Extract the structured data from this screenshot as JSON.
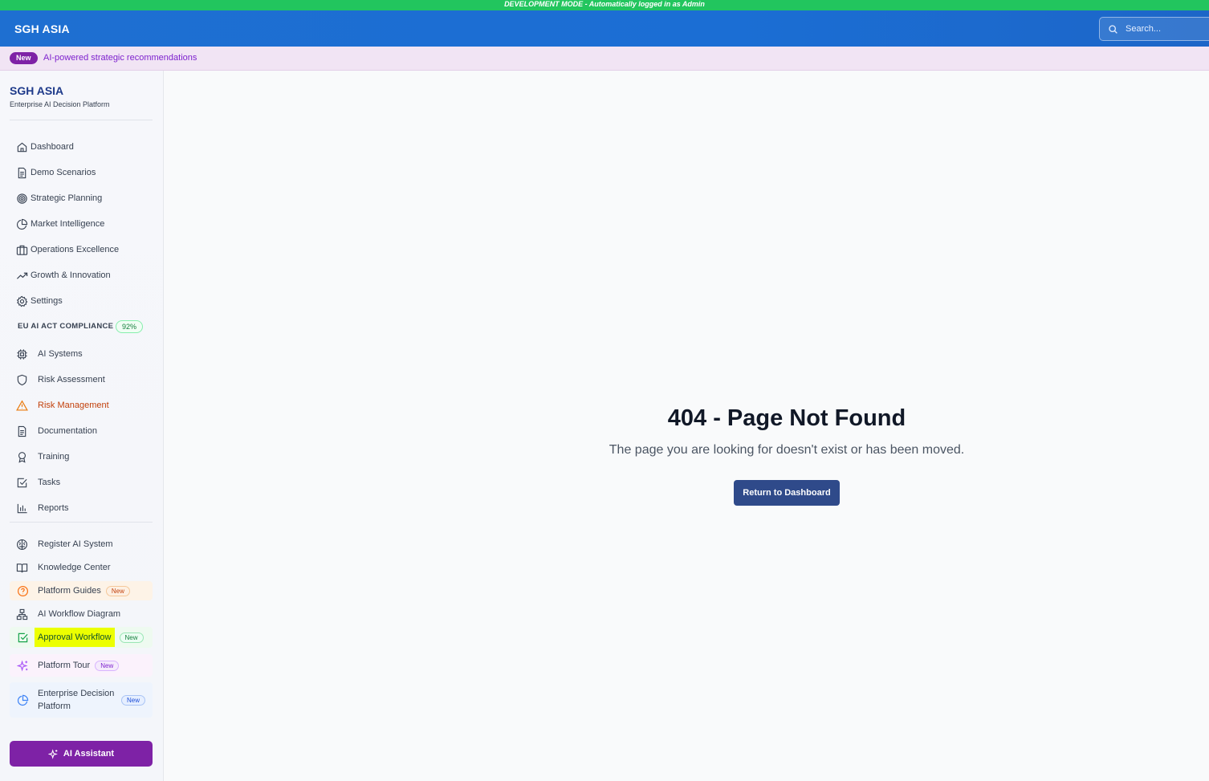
{
  "dev_banner": "DEVELOPMENT MODE - Automatically logged in as Admin",
  "header": {
    "brand": "SGH ASIA",
    "search_placeholder": "Search..."
  },
  "announcement": {
    "badge": "New",
    "text": "AI-powered strategic recommendations"
  },
  "sidebar": {
    "title": "SGH ASIA",
    "subtitle": "Enterprise AI Decision Platform",
    "main_nav": [
      {
        "label": "Dashboard",
        "icon": "home-icon"
      },
      {
        "label": "Demo Scenarios",
        "icon": "document-icon"
      },
      {
        "label": "Strategic Planning",
        "icon": "target-icon"
      },
      {
        "label": "Market Intelligence",
        "icon": "pie-chart-icon"
      },
      {
        "label": "Operations Excellence",
        "icon": "briefcase-icon"
      },
      {
        "label": "Growth & Innovation",
        "icon": "trending-up-icon"
      },
      {
        "label": "Settings",
        "icon": "gear-icon"
      }
    ],
    "compliance": {
      "label": "EU AI ACT COMPLIANCE",
      "badge": "92%",
      "items": [
        {
          "label": "AI Systems",
          "icon": "cpu-icon"
        },
        {
          "label": "Risk Assessment",
          "icon": "shield-icon"
        },
        {
          "label": "Risk Management",
          "icon": "warning-icon"
        },
        {
          "label": "Documentation",
          "icon": "file-text-icon"
        },
        {
          "label": "Training",
          "icon": "award-icon"
        },
        {
          "label": "Tasks",
          "icon": "check-square-icon"
        },
        {
          "label": "Reports",
          "icon": "bar-chart-icon"
        }
      ]
    },
    "extra": [
      {
        "label": "Register AI System",
        "icon": "brain-icon"
      },
      {
        "label": "Knowledge Center",
        "icon": "book-open-icon"
      },
      {
        "label": "Platform Guides",
        "badge": "New",
        "icon": "help-circle-icon"
      },
      {
        "label": "AI Workflow Diagram",
        "icon": "workflow-icon"
      },
      {
        "label": "Approval Workflow",
        "badge": "New",
        "icon": "check-square-icon"
      },
      {
        "label": "Platform Tour",
        "badge": "New",
        "icon": "sparkles-icon"
      },
      {
        "label": "Enterprise Decision Platform",
        "badge": "New",
        "icon": "pie-chart-icon"
      }
    ],
    "assistant_button": "AI Assistant"
  },
  "error": {
    "title": "404 - Page Not Found",
    "message": "The page you are looking for doesn't exist or has been moved.",
    "button": "Return to Dashboard"
  },
  "colors": {
    "dev_banner": "#22c55e",
    "header": "#1e6fd1",
    "accent_purple": "#7e22a6",
    "primary_button": "#2f4a8a",
    "warning": "#c2410c",
    "highlight": "#ecff00"
  }
}
